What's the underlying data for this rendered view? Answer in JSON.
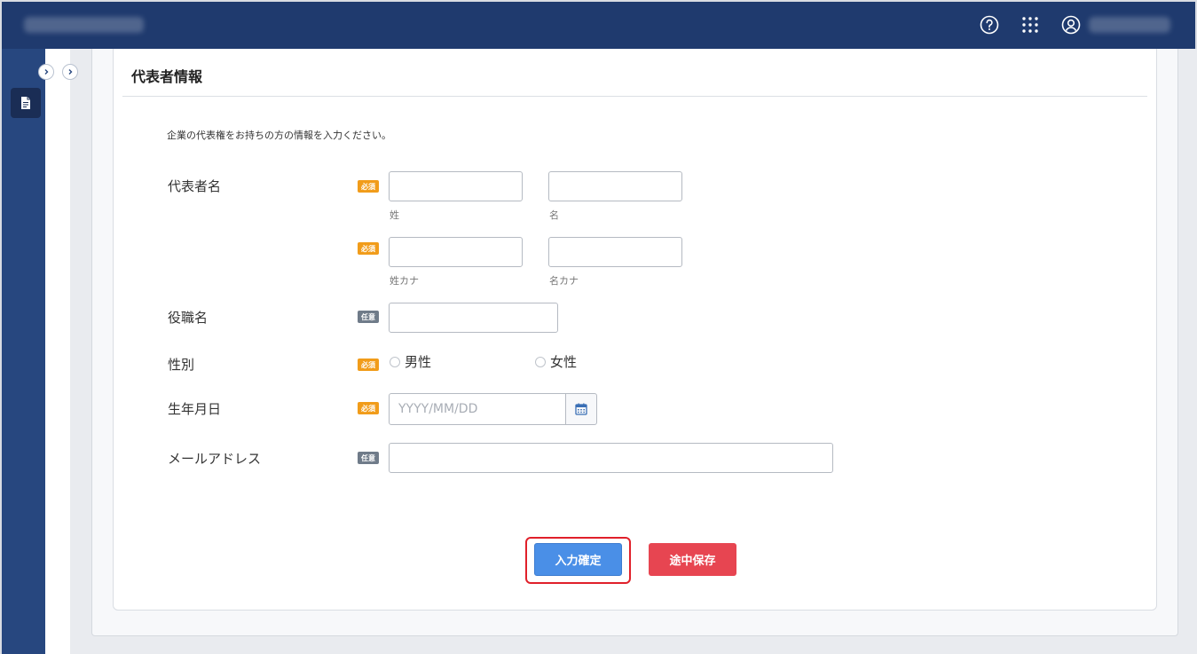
{
  "section": {
    "title": "代表者情報",
    "intro": "企業の代表権をお持ちの方の情報を入力ください。"
  },
  "badges": {
    "required": "必須",
    "optional": "任意"
  },
  "fields": {
    "rep_name": {
      "label": "代表者名",
      "last_name_sub": "姓",
      "first_name_sub": "名",
      "last_kana_sub": "姓カナ",
      "first_kana_sub": "名カナ"
    },
    "title": {
      "label": "役職名"
    },
    "gender": {
      "label": "性別",
      "options": [
        "男性",
        "女性"
      ]
    },
    "birthdate": {
      "label": "生年月日",
      "placeholder": "YYYY/MM/DD"
    },
    "email": {
      "label": "メールアドレス"
    }
  },
  "buttons": {
    "confirm": "入力確定",
    "save_draft": "途中保存"
  },
  "icons": {
    "help": "help-circle-icon",
    "apps": "grid-icon",
    "user": "user-icon",
    "doc": "document-icon",
    "calendar": "calendar-icon"
  },
  "colors": {
    "header": "#1f3a6e",
    "sidebar": "#27477f",
    "required_badge": "#f19c1a",
    "optional_badge": "#6f7b89",
    "primary_button": "#4a8fe7",
    "danger_button": "#e74551",
    "highlight": "#e0202a"
  }
}
